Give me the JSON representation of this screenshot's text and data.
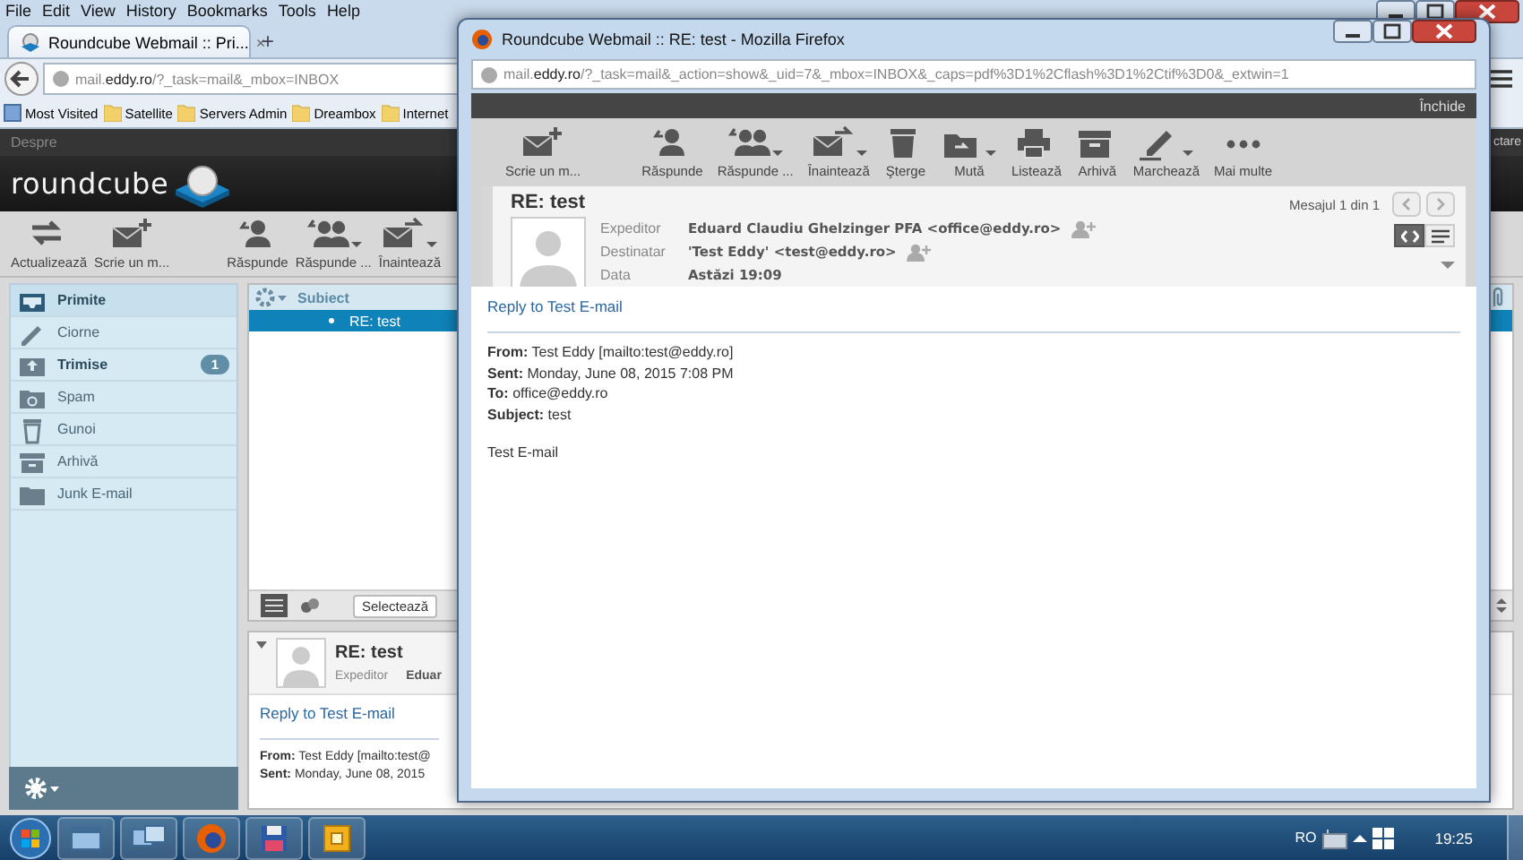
{
  "browser": {
    "menu": [
      "File",
      "Edit",
      "View",
      "History",
      "Bookmarks",
      "Tools",
      "Help"
    ],
    "tab": {
      "title": "Roundcube Webmail :: Pri...",
      "close": "×",
      "new_tab": "+"
    },
    "url": "mail.**eddy.ro**/?_task=mail&_mbox=INBOX",
    "bookmarks": [
      {
        "kind": "smart",
        "label": "Most Visited"
      },
      {
        "kind": "folder",
        "label": "Satellite"
      },
      {
        "kind": "folder",
        "label": "Servers Admin"
      },
      {
        "kind": "folder",
        "label": "Dreambox"
      },
      {
        "kind": "folder",
        "label": "Internet"
      }
    ]
  },
  "app": {
    "top_link": "Despre",
    "top_right": "ctare",
    "logo": "roundcube",
    "toolbar": [
      {
        "kind": "refresh",
        "label": "Actualizează",
        "has_menu": false
      },
      {
        "kind": "compose",
        "label": "Scrie un m...",
        "has_menu": false
      },
      {
        "kind": "reply",
        "label": "Răspunde",
        "has_menu": false
      },
      {
        "kind": "reply_all",
        "label": "Răspunde ...",
        "has_menu": true
      },
      {
        "kind": "forward",
        "label": "Înaintează",
        "has_menu": true
      }
    ],
    "folders": [
      {
        "kind": "inbox",
        "name": "Primite",
        "selected": true,
        "unread": false
      },
      {
        "kind": "drafts",
        "name": "Ciorne",
        "selected": false,
        "unread": false
      },
      {
        "kind": "sent",
        "name": "Trimise",
        "selected": false,
        "unread": true,
        "count": "1"
      },
      {
        "kind": "spam",
        "name": "Spam",
        "selected": false,
        "unread": false
      },
      {
        "kind": "trash",
        "name": "Gunoi",
        "selected": false,
        "unread": false
      },
      {
        "kind": "archive",
        "name": "Arhivă",
        "selected": false,
        "unread": false
      },
      {
        "kind": "folder",
        "name": "Junk E-mail",
        "selected": false,
        "unread": false
      }
    ],
    "list": {
      "column": "Subiect",
      "rows": [
        {
          "subject": "RE: test",
          "selected": true
        }
      ],
      "select": "Selectează"
    },
    "preview": {
      "subject": "RE: test",
      "sender_label": "Expeditor",
      "sender_value": "Eduar",
      "reply_link": "Reply to Test E-mail",
      "lines": [
        "**From:** Test Eddy [mailto:test@",
        "**Sent:** Monday, June 08, 2015"
      ]
    }
  },
  "popup": {
    "title": "Roundcube Webmail :: RE: test - Mozilla Firefox",
    "url": "mail.**eddy.ro**/?_task=mail&_action=show&_uid=7&_mbox=INBOX&_caps=pdf%3D1%2Cflash%3D1%2Ctif%3D0&_extwin=1",
    "close_link": "Închide",
    "toolbar": [
      {
        "kind": "compose",
        "label": "Scrie un m...",
        "has_menu": false
      },
      {
        "kind": "reply",
        "label": "Răspunde",
        "has_menu": false
      },
      {
        "kind": "reply_all",
        "label": "Răspunde ...",
        "has_menu": true
      },
      {
        "kind": "forward",
        "label": "Înaintează",
        "has_menu": true
      },
      {
        "kind": "delete",
        "label": "Şterge",
        "has_menu": false
      },
      {
        "kind": "move",
        "label": "Mută",
        "has_menu": true
      },
      {
        "kind": "print",
        "label": "Listează",
        "has_menu": false
      },
      {
        "kind": "archive",
        "label": "Arhivă",
        "has_menu": false
      },
      {
        "kind": "mark",
        "label": "Marchează",
        "has_menu": true
      },
      {
        "kind": "more",
        "label": "Mai multe",
        "has_menu": false
      }
    ],
    "subject": "RE: test",
    "counter": "Mesajul 1 din 1",
    "headers": [
      {
        "label": "Expeditor",
        "value": "Eduard Claudiu Ghelzinger PFA <office@eddy.ro>",
        "add_contact": true
      },
      {
        "label": "Destinatar",
        "value": "'Test Eddy' <test@eddy.ro>",
        "add_contact": true
      },
      {
        "label": "Data",
        "value": "Astăzi 19:09",
        "add_contact": false
      }
    ],
    "view_modes": [
      {
        "kind": "html",
        "selected": true
      },
      {
        "kind": "plain",
        "selected": false
      }
    ],
    "reply_link": "Reply to Test E-mail",
    "lines": [
      "**From:** Test Eddy [mailto:test@eddy.ro]",
      "**Sent:** Monday, June 08, 2015 7:08 PM",
      "**To:** office@eddy.ro",
      "**Subject:** test"
    ],
    "body": "Test E-mail"
  },
  "taskbar": {
    "apps": [
      {
        "kind": "explorer"
      },
      {
        "kind": "window"
      },
      {
        "kind": "firefox"
      },
      {
        "kind": "save"
      },
      {
        "kind": "outlook"
      }
    ],
    "language": "RO",
    "clock": "19:25"
  }
}
